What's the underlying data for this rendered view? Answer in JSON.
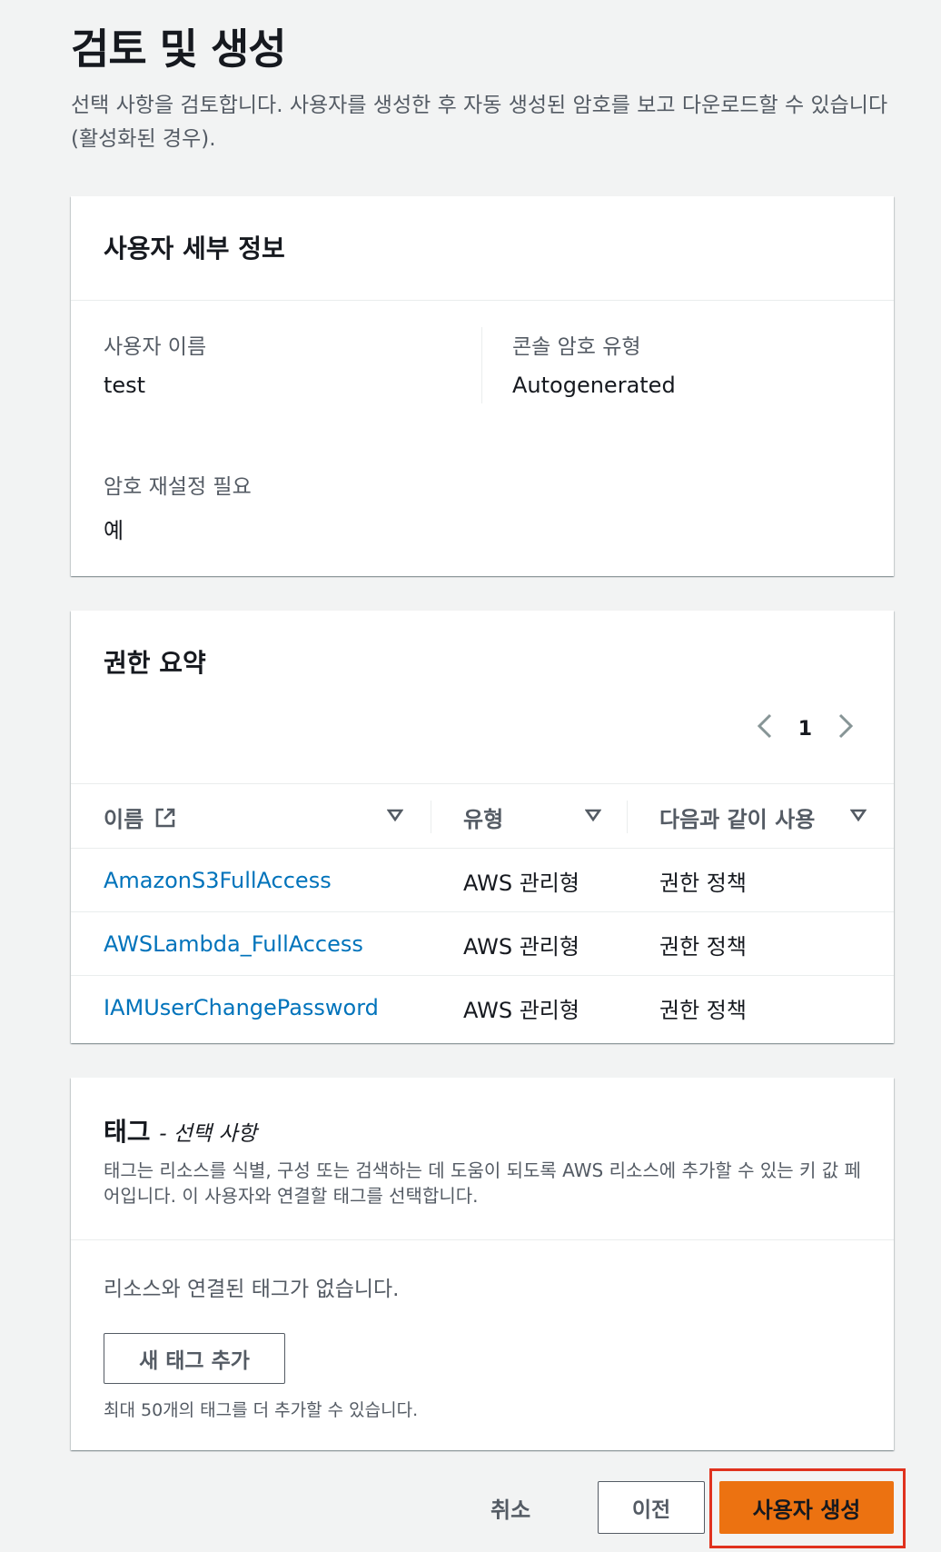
{
  "page": {
    "title": "검토 및 생성",
    "description": "선택 사항을 검토합니다. 사용자를 생성한 후 자동 생성된 암호를 보고 다운로드할 수 있습니다(활성화된 경우)."
  },
  "user_details": {
    "title": "사용자 세부 정보",
    "username_label": "사용자 이름",
    "username_value": "test",
    "console_password_type_label": "콘솔 암호 유형",
    "console_password_type_value": "Autogenerated",
    "require_reset_label": "암호 재설정 필요",
    "require_reset_value": "예"
  },
  "permissions": {
    "title": "권한 요약",
    "pagination": {
      "current_page": "1",
      "prev_icon": "chevron-left-icon",
      "next_icon": "chevron-right-icon"
    },
    "columns": {
      "name": "이름",
      "type": "유형",
      "used_as": "다음과 같이 사용"
    },
    "rows": [
      {
        "name": "AmazonS3FullAccess",
        "type": "AWS 관리형",
        "used_as": "권한 정책"
      },
      {
        "name": "AWSLambda_FullAccess",
        "type": "AWS 관리형",
        "used_as": "권한 정책"
      },
      {
        "name": "IAMUserChangePassword",
        "type": "AWS 관리형",
        "used_as": "권한 정책"
      }
    ]
  },
  "tags": {
    "title": "태그",
    "optional": "- 선택 사항",
    "description": "태그는 리소스를 식별, 구성 또는 검색하는 데 도움이 되도록 AWS 리소스에 추가할 수 있는 키 값 페어입니다. 이 사용자와 연결할 태그를 선택합니다.",
    "empty_message": "리소스와 연결된 태그가 없습니다.",
    "add_button": "새 태그 추가",
    "limit_hint": "최대 50개의 태그를 더 추가할 수 있습니다."
  },
  "footer": {
    "cancel": "취소",
    "previous": "이전",
    "create_user": "사용자 생성"
  },
  "colors": {
    "primary_button": "#ec7211",
    "link": "#0073bb",
    "highlight_box": "#e0321e"
  }
}
